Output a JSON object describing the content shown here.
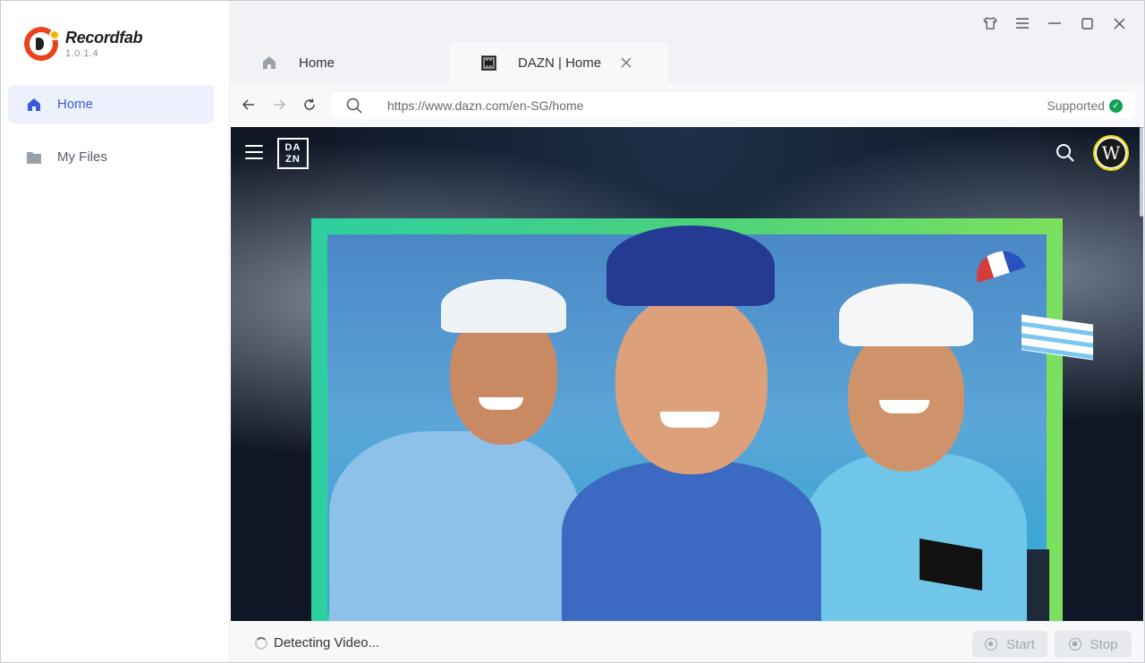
{
  "app": {
    "name": "Recordfab",
    "version": "1.0.1.4"
  },
  "sidebar": {
    "items": [
      {
        "label": "Home",
        "icon": "home-icon",
        "active": true
      },
      {
        "label": "My Files",
        "icon": "folder-icon",
        "active": false
      }
    ]
  },
  "window_controls": {
    "icons": [
      "shirt-icon",
      "menu-icon",
      "minimize-icon",
      "maximize-icon",
      "close-icon"
    ]
  },
  "tabs": [
    {
      "label": "Home",
      "icon": "home-icon",
      "closable": false
    },
    {
      "label": "DAZN | Home",
      "icon": "dazn-favicon-icon",
      "closable": true,
      "active": true
    }
  ],
  "address_bar": {
    "url": "https://www.dazn.com/en-SG/home",
    "status": "Supported"
  },
  "webpage": {
    "logo_text_top": "DA",
    "logo_text_bottom": "ZN",
    "avatar_letter": "W"
  },
  "status_bar": {
    "status_text": "Detecting Video...",
    "start_label": "Start",
    "stop_label": "Stop"
  },
  "colors": {
    "accent": "#3b5bdb",
    "active_nav_bg": "#ecf1fd",
    "supported_green": "#12a150",
    "brand_red": "#e8431d"
  }
}
